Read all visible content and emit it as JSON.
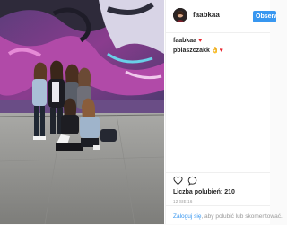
{
  "post": {
    "username": "faabkaa",
    "follow_label": "Obserwuj",
    "comments": [
      {
        "username": "faabkaa",
        "text": "",
        "emoji": "♥"
      },
      {
        "username": "pblaszczakk",
        "text": "",
        "emoji": "👌♥"
      }
    ],
    "likes_label": "Liczba polubień:",
    "likes_count": "210",
    "date": "12 SIE 16",
    "login_link": "Zaloguj się",
    "login_rest": ", aby polubić lub skomentować."
  },
  "colors": {
    "follow_button": "#3897f0",
    "link": "#3897f0",
    "heart": "#e8262f"
  },
  "icons": {
    "like": "heart-outline-icon",
    "comment": "speech-bubble-icon",
    "avatar": "profile-photo"
  }
}
